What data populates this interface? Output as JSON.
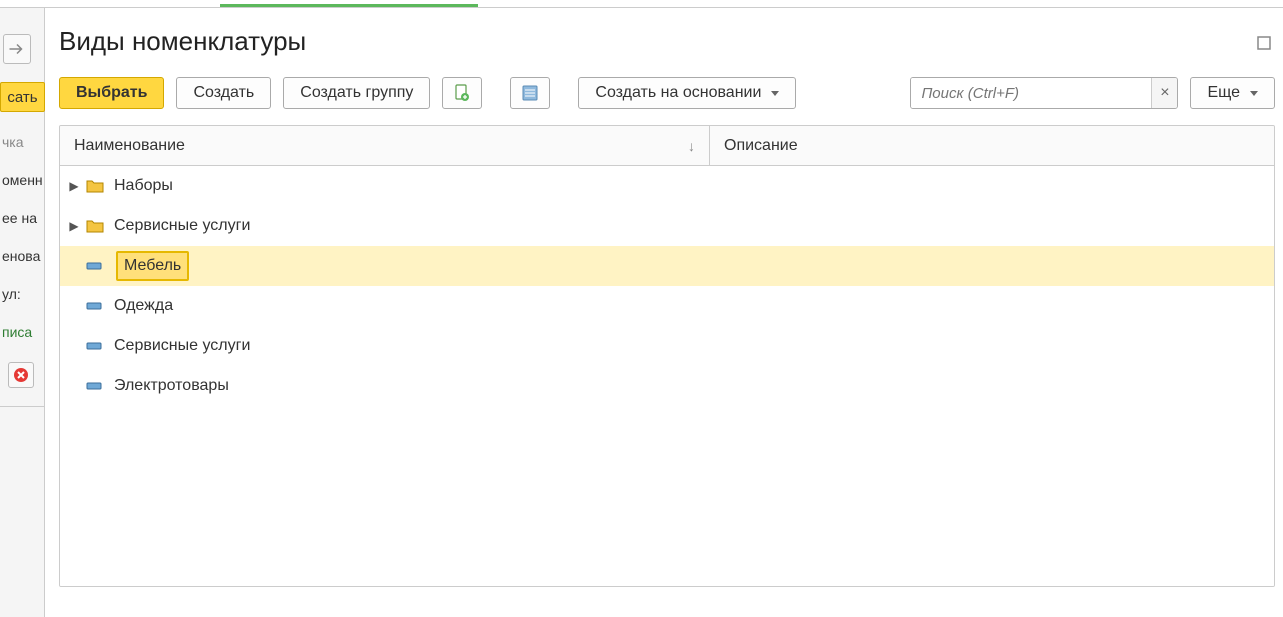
{
  "page": {
    "title": "Виды номенклатуры"
  },
  "leftPanel": {
    "yellow_btn": "сать",
    "lbl1": "чка",
    "lbl2": "оменн",
    "lbl3": "ее на",
    "lbl4": "енова",
    "lbl5": "ул:",
    "lbl6": "писа"
  },
  "toolbar": {
    "select": "Выбрать",
    "create": "Создать",
    "create_group": "Создать группу",
    "create_based": "Создать на основании",
    "more": "Еще",
    "search_placeholder": "Поиск (Ctrl+F)",
    "clear": "×"
  },
  "table": {
    "col_name": "Наименование",
    "col_desc": "Описание",
    "sort_arrow": "↓",
    "rows": [
      {
        "label": "Наборы"
      },
      {
        "label": "Сервисные услуги"
      },
      {
        "label": "Мебель"
      },
      {
        "label": "Одежда"
      },
      {
        "label": "Сервисные услуги"
      },
      {
        "label": "Электротовары"
      }
    ]
  }
}
